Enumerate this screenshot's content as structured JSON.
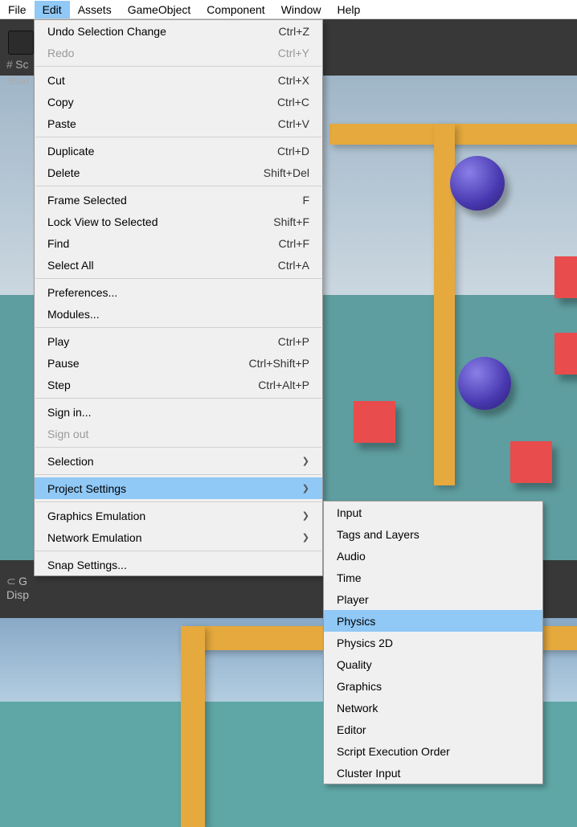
{
  "menubar": {
    "items": [
      "File",
      "Edit",
      "Assets",
      "GameObject",
      "Component",
      "Window",
      "Help"
    ],
    "active_index": 1
  },
  "toolbar": {
    "scene_tab": "Sc",
    "shaded": "Shad"
  },
  "game_panel": {
    "label_g": "G",
    "label_disp": "Disp"
  },
  "edit_menu": {
    "groups": [
      [
        {
          "label": "Undo Selection Change",
          "shortcut": "Ctrl+Z"
        },
        {
          "label": "Redo",
          "shortcut": "Ctrl+Y",
          "disabled": true
        }
      ],
      [
        {
          "label": "Cut",
          "shortcut": "Ctrl+X"
        },
        {
          "label": "Copy",
          "shortcut": "Ctrl+C"
        },
        {
          "label": "Paste",
          "shortcut": "Ctrl+V"
        }
      ],
      [
        {
          "label": "Duplicate",
          "shortcut": "Ctrl+D"
        },
        {
          "label": "Delete",
          "shortcut": "Shift+Del"
        }
      ],
      [
        {
          "label": "Frame Selected",
          "shortcut": "F"
        },
        {
          "label": "Lock View to Selected",
          "shortcut": "Shift+F"
        },
        {
          "label": "Find",
          "shortcut": "Ctrl+F"
        },
        {
          "label": "Select All",
          "shortcut": "Ctrl+A"
        }
      ],
      [
        {
          "label": "Preferences..."
        },
        {
          "label": "Modules..."
        }
      ],
      [
        {
          "label": "Play",
          "shortcut": "Ctrl+P"
        },
        {
          "label": "Pause",
          "shortcut": "Ctrl+Shift+P"
        },
        {
          "label": "Step",
          "shortcut": "Ctrl+Alt+P"
        }
      ],
      [
        {
          "label": "Sign in..."
        },
        {
          "label": "Sign out",
          "disabled": true
        }
      ],
      [
        {
          "label": "Selection",
          "submenu": true
        }
      ],
      [
        {
          "label": "Project Settings",
          "submenu": true,
          "hover": true
        }
      ],
      [
        {
          "label": "Graphics Emulation",
          "submenu": true
        },
        {
          "label": "Network Emulation",
          "submenu": true
        }
      ],
      [
        {
          "label": "Snap Settings..."
        }
      ]
    ]
  },
  "sub_menu": {
    "items": [
      {
        "label": "Input"
      },
      {
        "label": "Tags and Layers"
      },
      {
        "label": "Audio"
      },
      {
        "label": "Time"
      },
      {
        "label": "Player"
      },
      {
        "label": "Physics",
        "hover": true
      },
      {
        "label": "Physics 2D"
      },
      {
        "label": "Quality"
      },
      {
        "label": "Graphics"
      },
      {
        "label": "Network"
      },
      {
        "label": "Editor"
      },
      {
        "label": "Script Execution Order"
      },
      {
        "label": "Cluster Input"
      }
    ]
  }
}
